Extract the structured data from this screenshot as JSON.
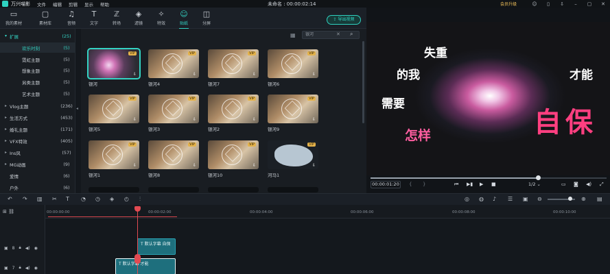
{
  "titlebar": {
    "app_name": "万兴喵影",
    "menus": [
      "文件",
      "编辑",
      "剪辑",
      "显示",
      "帮助"
    ],
    "doc_title": "未命名 : 00:00:02:14",
    "vip_label": "会员升级"
  },
  "toolbar": {
    "tools": [
      {
        "icon": "▭",
        "label": "我的素材"
      },
      {
        "icon": "▢",
        "label": "素材库"
      },
      {
        "icon": "♫",
        "label": "音频"
      },
      {
        "icon": "T",
        "label": "文字"
      },
      {
        "icon": "ℤ",
        "label": "转场"
      },
      {
        "icon": "◈",
        "label": "滤镜"
      },
      {
        "icon": "✧",
        "label": "特效"
      },
      {
        "icon": "☺",
        "label": "贴纸"
      },
      {
        "icon": "◫",
        "label": "分屏"
      }
    ],
    "export_label": "导出视频"
  },
  "categories": [
    {
      "arrow": "▾",
      "name": "扩展",
      "count": "(25)"
    },
    {
      "arrow": "",
      "name": "欢乐时刻",
      "count": "(5)"
    },
    {
      "arrow": "",
      "name": "霓虹主题",
      "count": "(5)"
    },
    {
      "arrow": "",
      "name": "想象主题",
      "count": "(5)"
    },
    {
      "arrow": "",
      "name": "另类主题",
      "count": "(5)"
    },
    {
      "arrow": "",
      "name": "艺术主题",
      "count": "(5)"
    },
    {
      "arrow": "▸",
      "name": "Vlog主题",
      "count": "(236)"
    },
    {
      "arrow": "▸",
      "name": "生活方式",
      "count": "(453)"
    },
    {
      "arrow": "▸",
      "name": "婚礼主题",
      "count": "(171)"
    },
    {
      "arrow": "▸",
      "name": "VFX特效",
      "count": "(405)"
    },
    {
      "arrow": "▸",
      "name": "Ins风",
      "count": "(57)"
    },
    {
      "arrow": "▸",
      "name": "MG动画",
      "count": "(9)"
    },
    {
      "arrow": "",
      "name": "爱情",
      "count": "(6)"
    },
    {
      "arrow": "",
      "name": "户外",
      "count": "(6)"
    }
  ],
  "search": {
    "placeholder": "银河"
  },
  "assets": [
    {
      "name": "银河",
      "vip": "VIP"
    },
    {
      "name": "银河4",
      "vip": "VIP"
    },
    {
      "name": "银河7",
      "vip": "VIP"
    },
    {
      "name": "银河6",
      "vip": "VIP"
    },
    {
      "name": "银河5",
      "vip": "VIP"
    },
    {
      "name": "银河3",
      "vip": "VIP"
    },
    {
      "name": "银河2",
      "vip": "VIP"
    },
    {
      "name": "银河9",
      "vip": "VIP"
    },
    {
      "name": "银河1",
      "vip": "VIP"
    },
    {
      "name": "银河8",
      "vip": "VIP"
    },
    {
      "name": "银河10",
      "vip": "VIP"
    },
    {
      "name": "河马1",
      "vip": "VIP"
    }
  ],
  "preview": {
    "texts": [
      "失重",
      "的我",
      "需要",
      "怎样",
      "才能",
      "自保"
    ],
    "timecode": "00:00:01:20",
    "brace_open": "{",
    "brace_close": "}",
    "zoom": "1/2",
    "progress": 0.71
  },
  "timeline": {
    "ruler": [
      "00:00:00:00",
      "00:00:02:00",
      "00:00:04:00",
      "00:00:06:00",
      "00:00:08:00",
      "00:00:10:00"
    ],
    "tracks": [
      "8",
      "7"
    ],
    "clips": [
      "默认字幕 自保",
      "默认字幕 才能"
    ]
  }
}
